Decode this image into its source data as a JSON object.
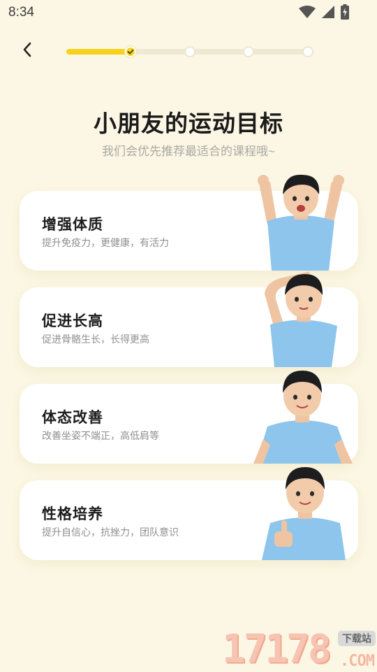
{
  "status_bar": {
    "time": "8:34",
    "icons": [
      "wifi-icon",
      "signal-icon",
      "battery-charging-icon"
    ]
  },
  "nav": {
    "back_icon": "chevron-left-icon",
    "progress": {
      "total_steps": 4,
      "current_step": 1,
      "colors": {
        "active": "#f7d21c",
        "inactive": "#efe9d4"
      }
    }
  },
  "header": {
    "title": "小朋友的运动目标",
    "subtitle": "我们会优先推荐最适合的课程哦~"
  },
  "goals": [
    {
      "title": "增强体质",
      "description": "提升免疫力，更健康，有活力",
      "image": "kid-cheering"
    },
    {
      "title": "促进长高",
      "description": "促进骨骼生长，长得更高",
      "image": "kid-measuring-height"
    },
    {
      "title": "体态改善",
      "description": "改善坐姿不端正，高低肩等",
      "image": "kid-hands-on-hips"
    },
    {
      "title": "性格培养",
      "description": "提升自信心，抗挫力，团队意识",
      "image": "kid-thumbs-up"
    }
  ],
  "watermark": {
    "digits": "17178",
    "tag": "下载站",
    "domain": ".COM"
  },
  "colors": {
    "background": "#fcf7e4",
    "card": "#ffffff",
    "accent": "#f7d21c",
    "shirt": "#8ec5ec"
  }
}
